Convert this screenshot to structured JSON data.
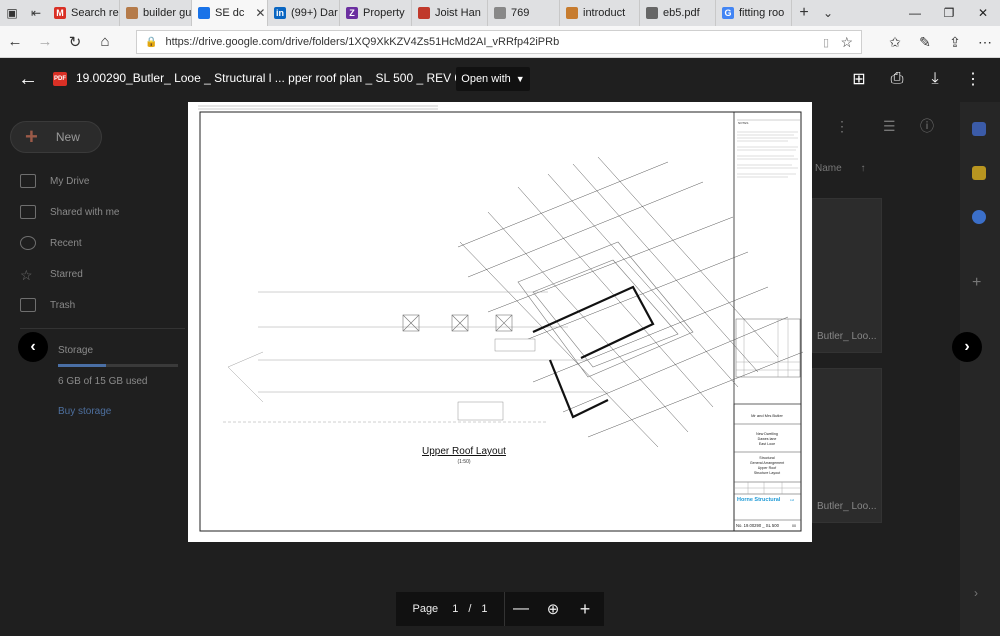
{
  "browser": {
    "tabs": [
      {
        "label": "Search re",
        "icon": "gmail-icon",
        "color": "#d93025",
        "glyph": "M",
        "active": false
      },
      {
        "label": "builder gu",
        "icon": "house-icon",
        "color": "#b57b4a",
        "glyph": "",
        "active": false
      },
      {
        "label": "SE dc",
        "icon": "drive-icon",
        "color": "#1a73e8",
        "glyph": "",
        "active": true
      },
      {
        "label": "(99+) Dar",
        "icon": "linkedin-icon",
        "color": "#0a66c2",
        "glyph": "in",
        "active": false
      },
      {
        "label": "Property",
        "icon": "zoopla-icon",
        "color": "#6b2fa0",
        "glyph": "Z",
        "active": false
      },
      {
        "label": "Joist Han",
        "icon": "site-icon",
        "color": "#c0392b",
        "glyph": "",
        "active": false
      },
      {
        "label": "769",
        "icon": "page-icon",
        "color": "#888888",
        "glyph": "",
        "active": false
      },
      {
        "label": "introduct",
        "icon": "doc-icon",
        "color": "#c77c2f",
        "glyph": "",
        "active": false
      },
      {
        "label": "eb5.pdf",
        "icon": "pdf-tab-icon",
        "color": "#666666",
        "glyph": "",
        "active": false
      },
      {
        "label": "fitting roo",
        "icon": "google-icon",
        "color": "#4285f4",
        "glyph": "G",
        "active": false
      }
    ],
    "url": "https://drive.google.com/drive/folders/1XQ9XkKZV4Zs51HcMd2AI_vRRfp42iPRb"
  },
  "drive": {
    "new_label": "New",
    "nav": [
      "My Drive",
      "Shared with me",
      "Recent",
      "Starred",
      "Trash"
    ],
    "storage_label": "Storage",
    "storage_used": "6 GB of 15 GB used",
    "buy_storage": "Buy storage",
    "column_name": "Name",
    "ghost_file_1": "Butler_ Loo...",
    "ghost_file_2": "Butler_ Loo..."
  },
  "viewer": {
    "file_title": "19.00290_Butler_ Looe _ Structural l ... pper roof plan _ SL 500 _ REV 00.pdf",
    "open_with": "Open with",
    "pdf_badge": "PDF"
  },
  "drawing": {
    "title": "Upper Roof Layout",
    "scale": "(1:50)",
    "client": "Mr and Mrs Butler",
    "project_lines": [
      "New Dwelling",
      "Dawes lane",
      "East Looe"
    ],
    "drawing_lines": [
      "Structural",
      "General Arrangement",
      "Upper Roof",
      "Structure Layout"
    ],
    "company": "Horne Structural",
    "company_suffix": "Ltd",
    "drawing_no": "No. 19.00290 _ SL 500",
    "revision": "00",
    "notes_heading": "NOTES"
  },
  "pager": {
    "page_label": "Page",
    "current": "1",
    "slash": "/",
    "total": "1"
  }
}
